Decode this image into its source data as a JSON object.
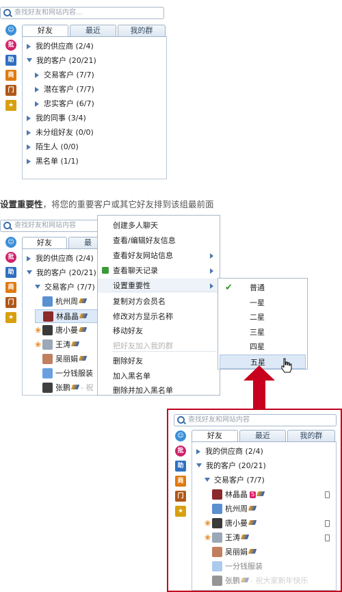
{
  "search": {
    "placeholder": "查找好友和网站内容..."
  },
  "tabs": [
    "好友",
    "最近",
    "我的群"
  ],
  "sidebar_icons": [
    "qq-icon",
    "pi-icon",
    "bang-icon",
    "shang-icon",
    "gift-icon",
    "star-icon"
  ],
  "sidebar_glyphs": [
    "☺",
    "批",
    "助",
    "商",
    "门",
    "★"
  ],
  "top_panel": {
    "groups": [
      {
        "label": "我的供应商 (2/4)",
        "expanded": false
      },
      {
        "label": "我的客户 (20/21)",
        "expanded": true
      },
      {
        "label": "交易客户 (7/7)",
        "expanded": false,
        "sub": true
      },
      {
        "label": "潜在客户 (7/7)",
        "expanded": false,
        "sub": true
      },
      {
        "label": "忠实客户 (6/7)",
        "expanded": false,
        "sub": true
      },
      {
        "label": "我的同事 (3/4)",
        "expanded": false
      },
      {
        "label": "未分组好友 (0/0)",
        "expanded": false
      },
      {
        "label": "陌生人 (0/0)",
        "expanded": false
      },
      {
        "label": "黑名单 (1/1)",
        "expanded": false
      }
    ]
  },
  "caption": {
    "bold": "设置重要性",
    "rest": "，将您的重要客户或其它好友排到该组最前面"
  },
  "middle_panel": {
    "search_placeholder": "查找好友和网站内容",
    "tab_active": "好友",
    "tab_partial": "最",
    "groups": [
      {
        "label": "我的供应商 (2/4)",
        "expanded": false
      },
      {
        "label": "我的客户 (20/21)",
        "expanded": true
      },
      {
        "label": "交易客户 (7/7)",
        "expanded": true,
        "sub": true
      }
    ],
    "contacts": [
      {
        "name": "杭州周",
        "vip": true,
        "flower": false,
        "selected": false
      },
      {
        "name": "林晶晶",
        "vip": true,
        "flower": false,
        "selected": true
      },
      {
        "name": "唐小曼",
        "vip": true,
        "flower": true,
        "selected": false
      },
      {
        "name": "王涛",
        "vip": true,
        "flower": true,
        "selected": false
      },
      {
        "name": "吴丽娟",
        "vip": true,
        "flower": false,
        "selected": false
      },
      {
        "name": "一分钱服装",
        "vip": false,
        "flower": false,
        "selected": false
      },
      {
        "name": "张鹏",
        "vip": true,
        "flower": false,
        "selected": false,
        "status": "- 祝"
      }
    ]
  },
  "context_menu": {
    "items": [
      {
        "label": "创建多人聊天",
        "submenu": false,
        "disabled": false
      },
      {
        "label": "查看/编辑好友信息",
        "submenu": false,
        "disabled": false
      },
      {
        "label": "查看好友网站信息",
        "submenu": true,
        "disabled": false
      },
      {
        "label": "查看聊天记录",
        "submenu": true,
        "disabled": false,
        "icon": true
      },
      {
        "label": "设置重要性",
        "submenu": true,
        "disabled": false,
        "highlight": true
      },
      {
        "label": "复制对方会员名",
        "submenu": false,
        "disabled": false
      },
      {
        "label": "修改对方显示名称",
        "submenu": false,
        "disabled": false
      },
      {
        "label": "移动好友",
        "submenu": false,
        "disabled": false
      },
      {
        "label": "把好友加入我的群",
        "submenu": false,
        "disabled": true
      },
      {
        "label": "删除好友",
        "submenu": false,
        "disabled": false
      },
      {
        "label": "加入黑名单",
        "submenu": false,
        "disabled": false
      },
      {
        "label": "删除并加入黑名单",
        "submenu": false,
        "disabled": false
      }
    ]
  },
  "importance_submenu": {
    "items": [
      {
        "label": "普通",
        "checked": true
      },
      {
        "label": "一星",
        "checked": false
      },
      {
        "label": "二星",
        "checked": false
      },
      {
        "label": "三星",
        "checked": false
      },
      {
        "label": "四星",
        "checked": false
      },
      {
        "label": "五星",
        "checked": false,
        "hover": true
      }
    ]
  },
  "result_panel": {
    "search_placeholder": "查找好友和网站内容",
    "groups": [
      {
        "label": "我的供应商 (2/4)",
        "expanded": false
      },
      {
        "label": "我的客户 (20/21)",
        "expanded": true
      },
      {
        "label": "交易客户 (7/7)",
        "expanded": true,
        "sub": true
      }
    ],
    "contacts": [
      {
        "name": "林晶晶",
        "badge": "5",
        "vip": true,
        "flower": false,
        "phone": true
      },
      {
        "name": "杭州周",
        "vip": true,
        "flower": false,
        "phone": false
      },
      {
        "name": "唐小曼",
        "vip": true,
        "flower": true,
        "phone": true
      },
      {
        "name": "王涛",
        "vip": true,
        "flower": true,
        "phone": true
      },
      {
        "name": "吴丽娟",
        "vip": true,
        "flower": false,
        "phone": false
      },
      {
        "name": "一分钱服装",
        "vip": false,
        "flower": false,
        "phone": false
      },
      {
        "name": "张鹏",
        "vip": true,
        "flower": false,
        "phone": false,
        "status": "- 祝大家新年快乐"
      }
    ]
  },
  "colors": {
    "accent": "#4a78b0",
    "arrow": "#c8001e",
    "border": "#b9c7d6",
    "highlight_row": "#dde9f7"
  }
}
